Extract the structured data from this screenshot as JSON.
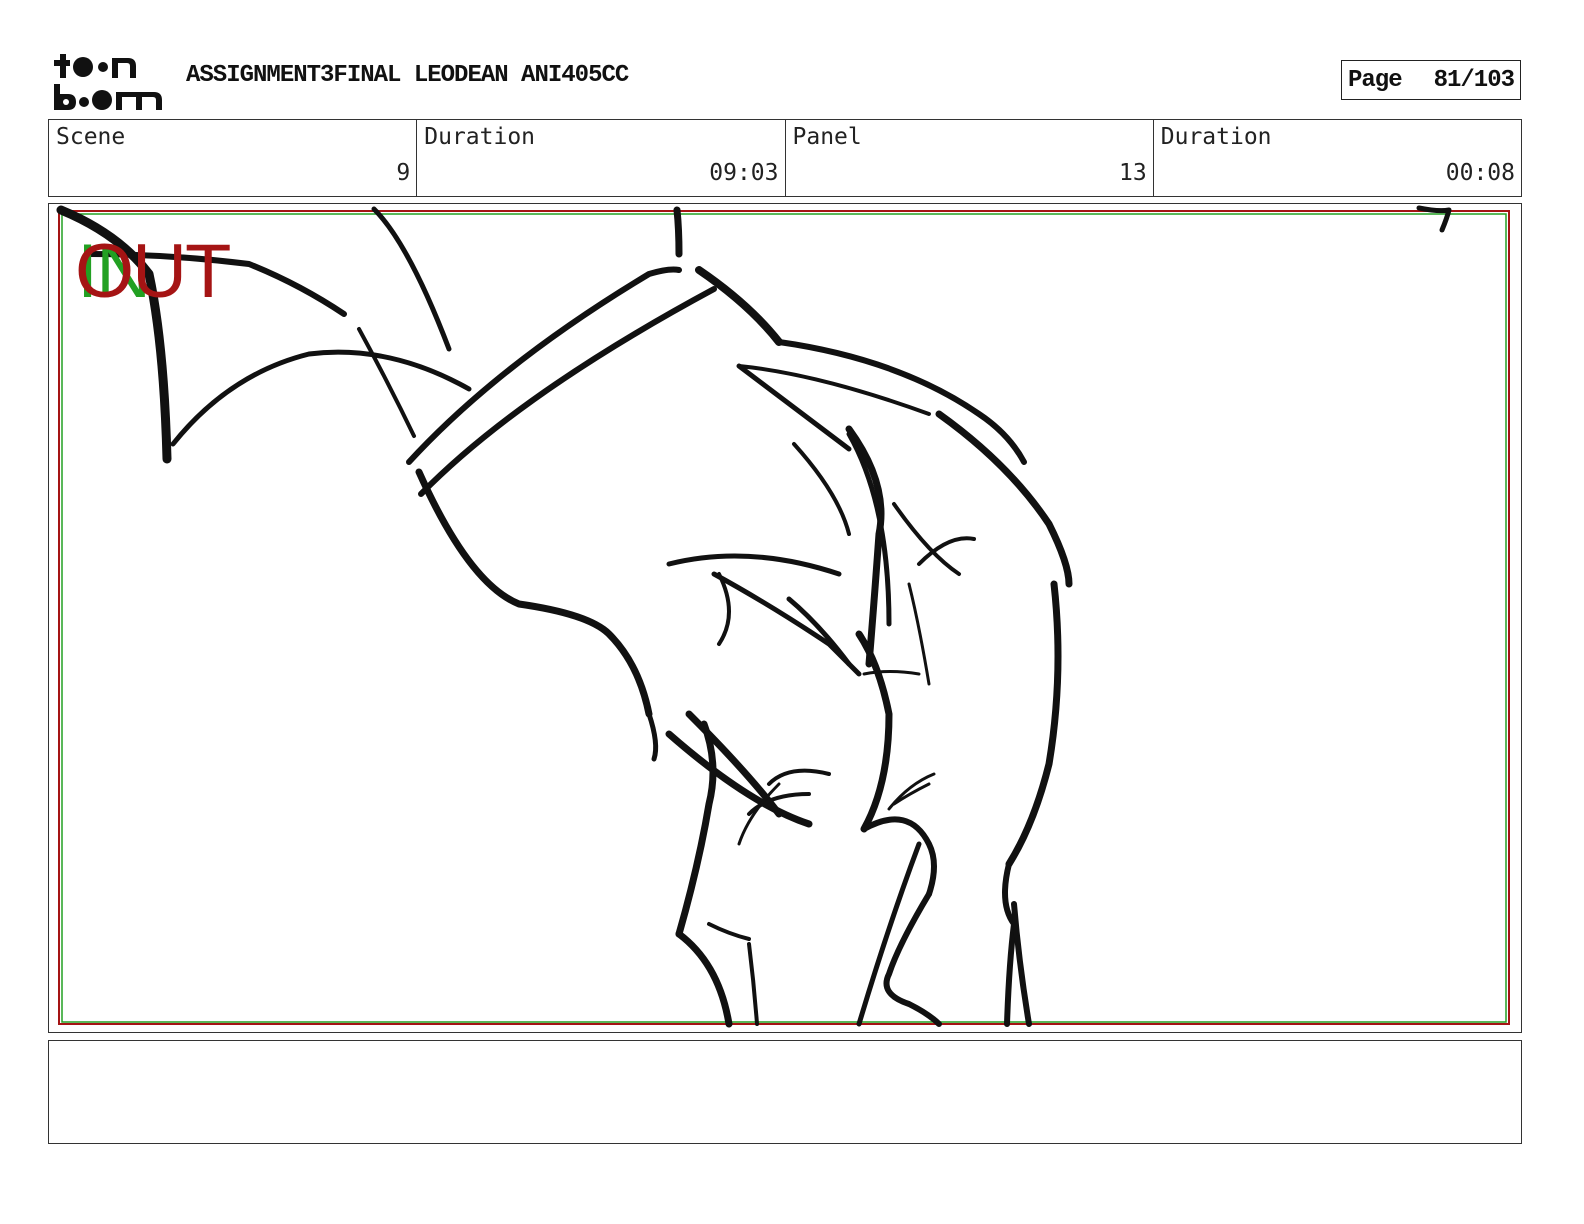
{
  "header": {
    "logo_text": "toon boom",
    "title": "ASSIGNMENT3FINAL LEODEAN ANI405CC",
    "page_label": "Page",
    "page_value": "81/103"
  },
  "info": {
    "scene_label": "Scene",
    "scene_value": "9",
    "scene_duration_label": "Duration",
    "scene_duration_value": "09:03",
    "panel_label": "Panel",
    "panel_value": "13",
    "panel_duration_label": "Duration",
    "panel_duration_value": "00:08"
  },
  "panel": {
    "in_marker": "IN",
    "out_marker": "OUT",
    "frame_in_color": "#22a022",
    "frame_out_color": "#a51414",
    "sketch_description_icon": "sketch-drawing"
  },
  "notes": {
    "text": ""
  }
}
